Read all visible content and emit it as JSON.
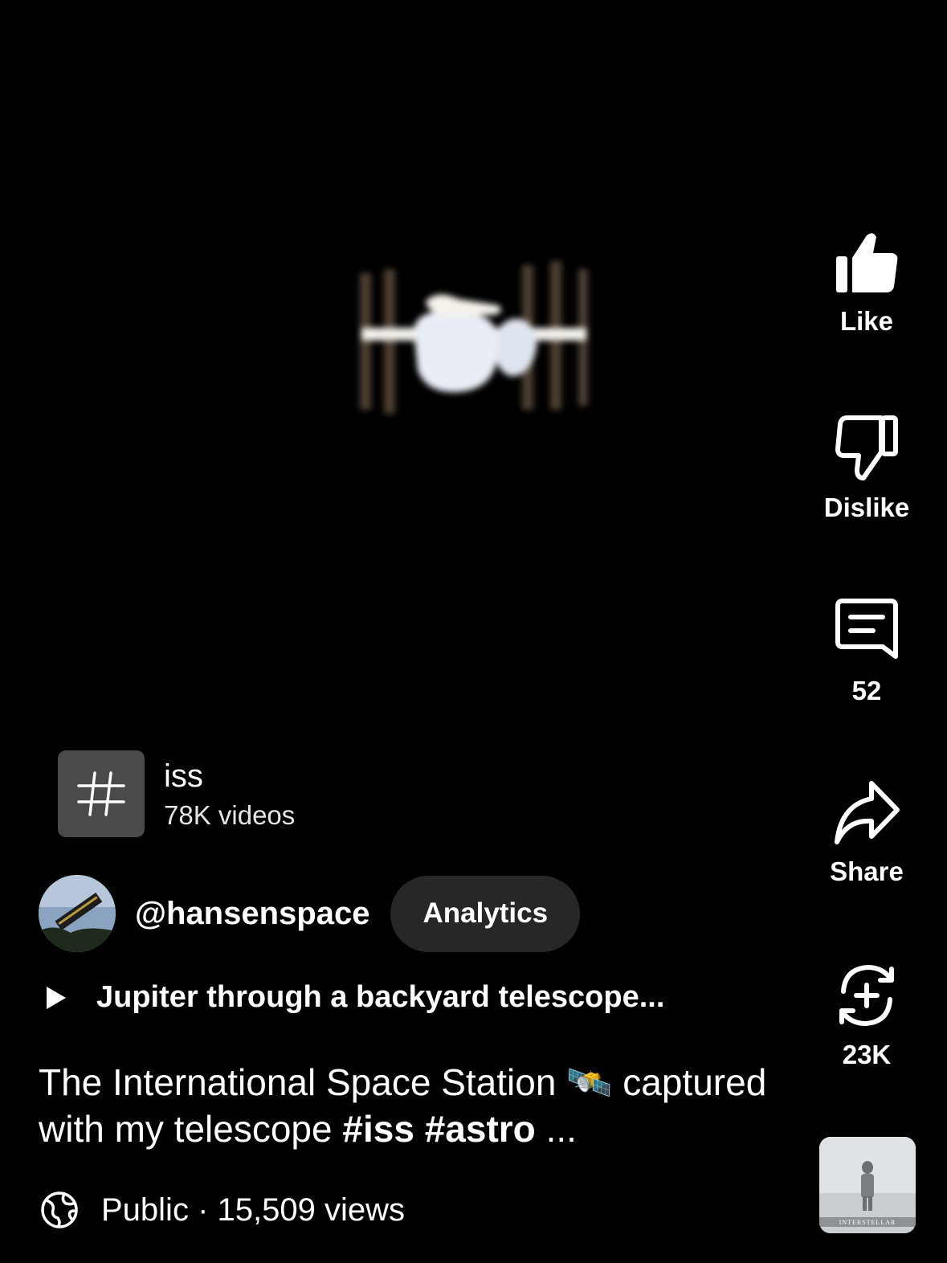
{
  "rail": {
    "like_label": "Like",
    "dislike_label": "Dislike",
    "comments_count": "52",
    "share_label": "Share",
    "remix_count": "23K"
  },
  "hashtag": {
    "symbol": "#",
    "name": "iss",
    "count": "78K videos"
  },
  "channel": {
    "handle": "@hansenspace",
    "analytics_label": "Analytics"
  },
  "playlist": {
    "title": "Jupiter through a backyard telescope..."
  },
  "description": {
    "text": "The International Space Station 🛰️ captured with my telescope",
    "tags": "#iss #astro",
    "ellipsis": "..."
  },
  "meta": {
    "visibility": "Public",
    "views": "15,509 views"
  },
  "sound_thumbnail": {
    "poster_text": "INTERSTELLAR"
  },
  "colors": {
    "background": "#000000",
    "chip": "#272727",
    "hash_box": "#4a4a4a"
  }
}
